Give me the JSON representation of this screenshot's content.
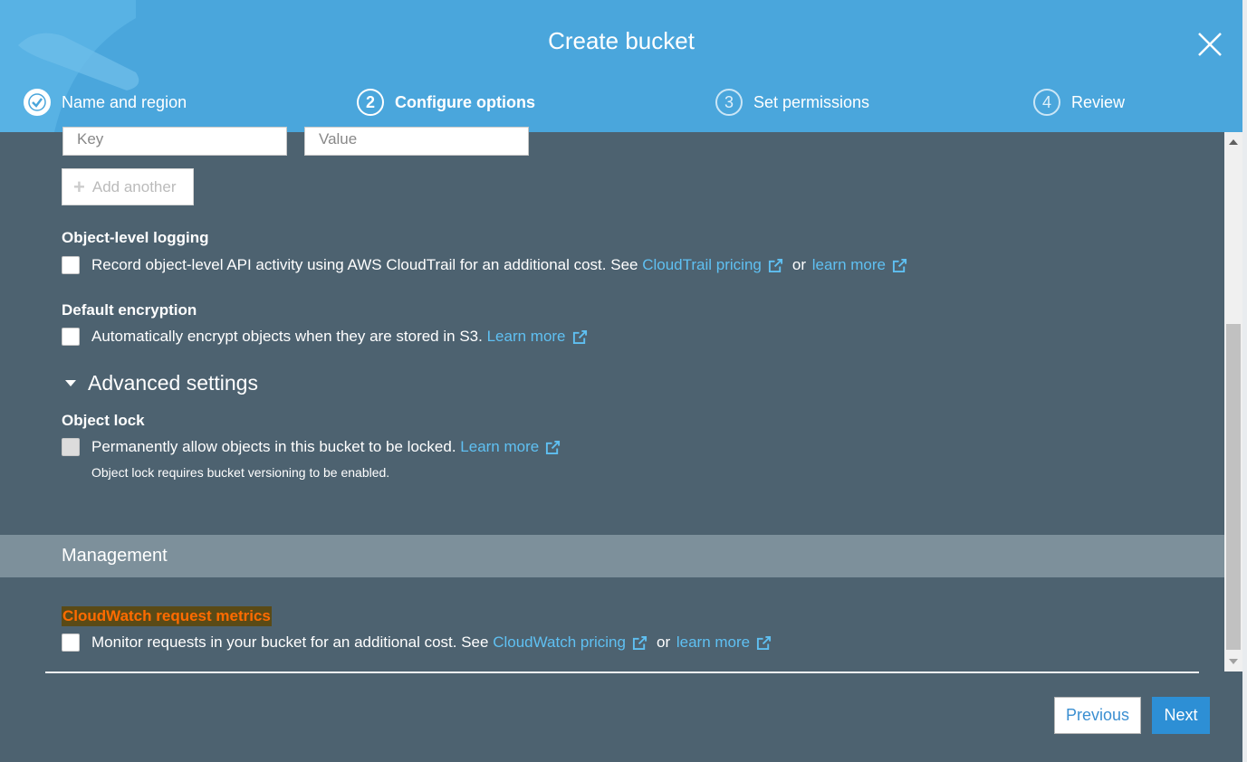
{
  "modal": {
    "title": "Create bucket"
  },
  "steps": [
    {
      "number": "1",
      "label": "Name and region",
      "state": "completed"
    },
    {
      "number": "2",
      "label": "Configure options",
      "state": "active"
    },
    {
      "number": "3",
      "label": "Set permissions",
      "state": "pending"
    },
    {
      "number": "4",
      "label": "Review",
      "state": "pending"
    }
  ],
  "tags": {
    "key_placeholder": "Key",
    "value_placeholder": "Value",
    "add_label": "Add another"
  },
  "object_logging": {
    "title": "Object-level logging",
    "text": "Record object-level API activity using AWS CloudTrail for an additional cost. See",
    "link1": "CloudTrail pricing",
    "or": "or",
    "link2": "learn more"
  },
  "encryption": {
    "title": "Default encryption",
    "text": "Automatically encrypt objects when they are stored in S3.",
    "link": "Learn more"
  },
  "advanced": {
    "label": "Advanced settings"
  },
  "object_lock": {
    "title": "Object lock",
    "text": "Permanently allow objects in this bucket to be locked.",
    "link": "Learn more",
    "note": "Object lock requires bucket versioning to be enabled."
  },
  "management": {
    "title": "Management",
    "cloudwatch_title": "CloudWatch request metrics",
    "cloudwatch_text": "Monitor requests in your bucket for an additional cost. See",
    "link1": "CloudWatch pricing",
    "or": "or",
    "link2": "learn more"
  },
  "footer": {
    "previous": "Previous",
    "next": "Next"
  },
  "colors": {
    "header": "#4aa6dc",
    "body": "#4d6270",
    "link": "#5fc0f2",
    "next_button": "#2d8fd5",
    "highlight": "#ff6b00"
  }
}
